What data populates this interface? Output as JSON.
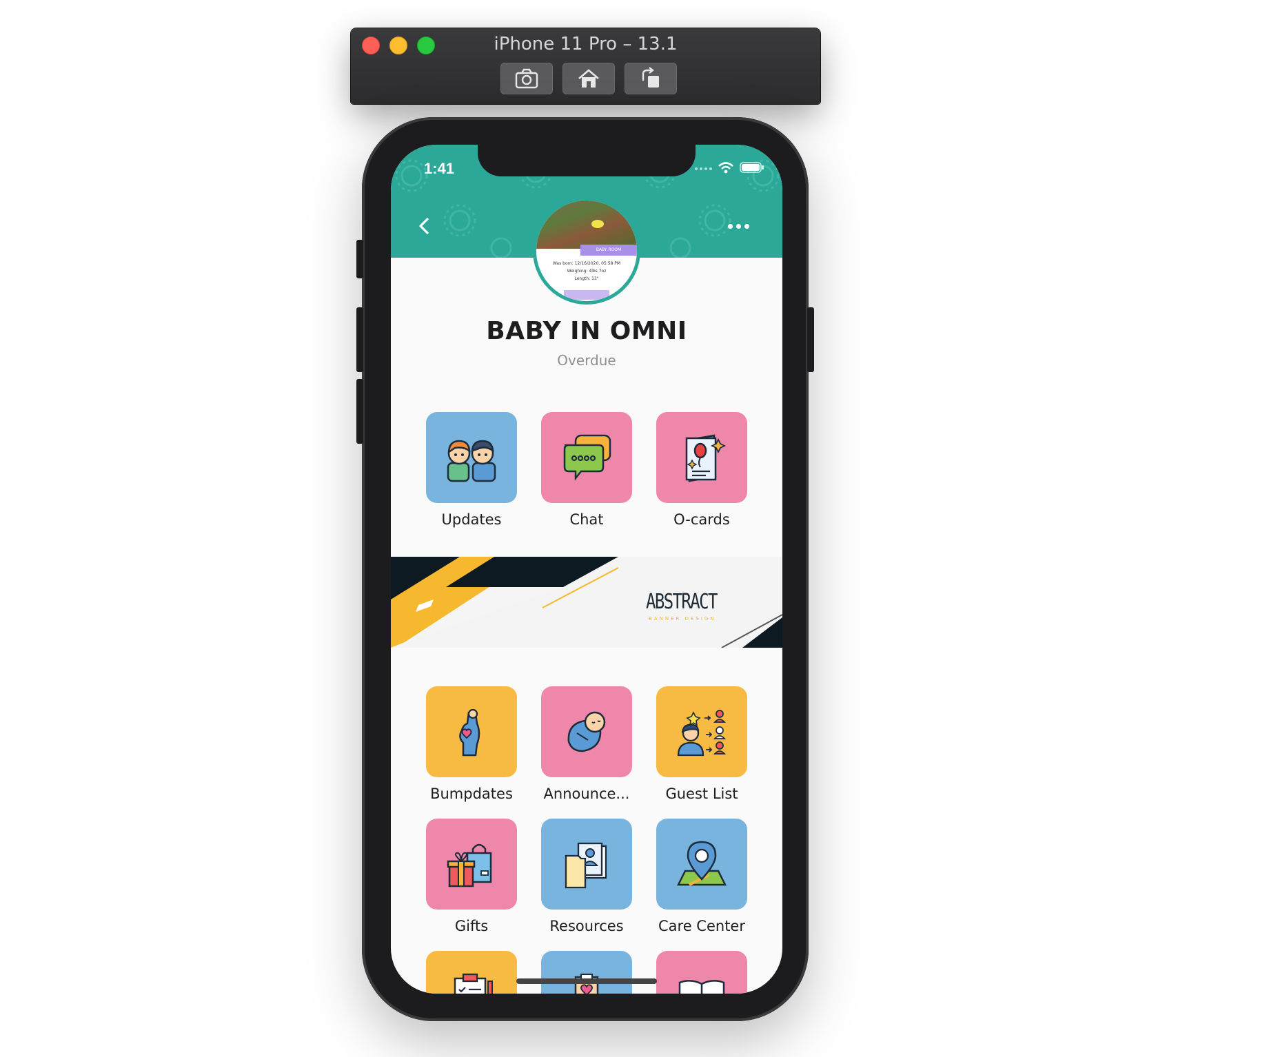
{
  "simulator": {
    "title": "iPhone 11 Pro – 13.1",
    "buttons": [
      {
        "icon": "screenshot-icon"
      },
      {
        "icon": "home-icon"
      },
      {
        "icon": "rotate-icon"
      }
    ]
  },
  "status_bar": {
    "time": "1:41",
    "icons": [
      "signal-icon",
      "wifi-icon",
      "battery-icon"
    ]
  },
  "header": {
    "color": "#2ca899",
    "back_icon": "chevron-left-icon",
    "more_icon": "more-icon"
  },
  "profile": {
    "name": "BABY IN OMNI",
    "status": "Overdue",
    "avatar_caption": "BABY ROOM",
    "avatar_lines": [
      "Was born: 12/16/2020, 05:58 PM",
      "Weighing: 4lbs 7oz",
      "Length: 13\""
    ]
  },
  "top_tiles": [
    {
      "label": "Updates",
      "color": "#78b4dd",
      "icon": "family-icon"
    },
    {
      "label": "Chat",
      "color": "#ef87ab",
      "icon": "chat-icon"
    },
    {
      "label": "O-cards",
      "color": "#ef87ab",
      "icon": "card-icon"
    }
  ],
  "banner": {
    "title": "ABSTRACT",
    "subtitle": "BANNER DESIGN"
  },
  "grid_tiles": [
    {
      "label": "Bumpdates",
      "color": "#f7bb43",
      "icon": "pregnant-icon"
    },
    {
      "label": "Announce...",
      "color": "#ef87ab",
      "icon": "baby-icon"
    },
    {
      "label": "Guest List",
      "color": "#f7bb43",
      "icon": "guests-icon"
    },
    {
      "label": "Gifts",
      "color": "#ef87ab",
      "icon": "gift-icon"
    },
    {
      "label": "Resources",
      "color": "#78b4dd",
      "icon": "documents-icon"
    },
    {
      "label": "Care Center",
      "color": "#78b4dd",
      "icon": "map-pin-icon"
    },
    {
      "label": "",
      "color": "#f7bb43",
      "icon": "checklist-icon"
    },
    {
      "label": "",
      "color": "#78b4dd",
      "icon": "clipboard-heart-icon"
    },
    {
      "label": "",
      "color": "#ef87ab",
      "icon": "book-icon"
    }
  ]
}
